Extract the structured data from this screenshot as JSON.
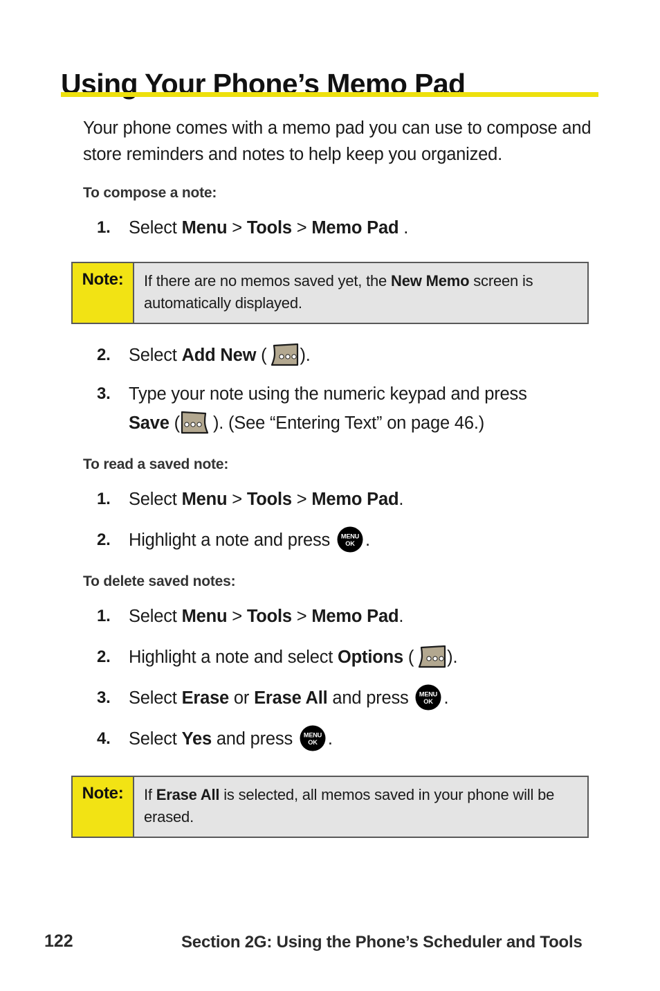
{
  "page": {
    "title": "Using Your Phone’s Memo Pad",
    "rule_color": "#ede00d",
    "intro": "Your phone comes with a memo pad you can use to compose and store reminders and notes to help keep you organized."
  },
  "sections": [
    {
      "heading": "To compose a note:",
      "steps": [
        {
          "num": "1.",
          "text_before": "Select ",
          "bold1": "Menu",
          "sep1": " > ",
          "bold2": "Tools",
          "sep2": " > ",
          "bold3": "Memo Pad",
          "text_after": " ."
        }
      ]
    },
    {
      "heading": "To read a saved note:",
      "steps": [
        {
          "num": "1.",
          "text_before": "Select ",
          "bold1": "Menu",
          "sep1": " > ",
          "bold2": "Tools",
          "sep2": " > ",
          "bold3": "Memo Pad",
          "text_after": "."
        },
        {
          "num": "2.",
          "text_before": "Highlight a note and press ",
          "text_after": "."
        }
      ]
    },
    {
      "heading": "To delete saved notes:",
      "steps": [
        {
          "num": "1.",
          "text_before": "Select ",
          "bold1": "Menu",
          "sep1": " > ",
          "bold2": "Tools",
          "sep2": " > ",
          "bold3": "Memo Pad",
          "text_after": "."
        },
        {
          "num": "2.",
          "text_before": "Highlight a note and select ",
          "bold1": "Options",
          "text_after": ")."
        },
        {
          "num": "3.",
          "text_before": "Select ",
          "bold1": "Erase",
          "sep1": " or ",
          "bold2": "Erase All",
          "text_after": " and press "
        },
        {
          "num": "4.",
          "text_before": "Select ",
          "bold1": "Yes",
          "text_after": " and press "
        }
      ]
    }
  ],
  "compose_steps": {
    "step2_lead": "Select ",
    "step2_bold": "Add New",
    "step2_open": " (",
    "step2_close": ").",
    "step3_line1": "Type your note using the numeric keypad and press",
    "step3_bold": "Save",
    "step3_open": " (",
    "step3_close": "). (See “Entering Text” on page 46.)"
  },
  "step_fragments": {
    "open_paren": "(",
    "close_paren": ")",
    "period": ".",
    "and_press": " and press ",
    "highlight_press": "Highlight a note and press ",
    "highlight_select": "Highlight a note and select "
  },
  "notes": [
    {
      "label": "Note:",
      "text_before": "If there are no memos saved yet, the ",
      "bold": "New Memo",
      "text_after": " screen is automatically displayed."
    },
    {
      "label": "Note:",
      "text_before": "If ",
      "bold": "Erase All",
      "text_after": " is selected, all memos saved in your phone will be erased."
    }
  ],
  "icons": {
    "softkey_left": "softkey-left-icon",
    "softkey_right": "softkey-right-icon",
    "menu_ok": "menu-ok-button-icon",
    "menu_ok_line1": "MENU",
    "menu_ok_line2": "OK",
    "softkey_fill": "#b3a890",
    "softkey_stroke": "#1a1a1a",
    "menu_ok_fill": "#000000"
  },
  "footer": {
    "page_number": "122",
    "section_title": "Section 2G: Using the Phone’s Scheduler and Tools"
  }
}
